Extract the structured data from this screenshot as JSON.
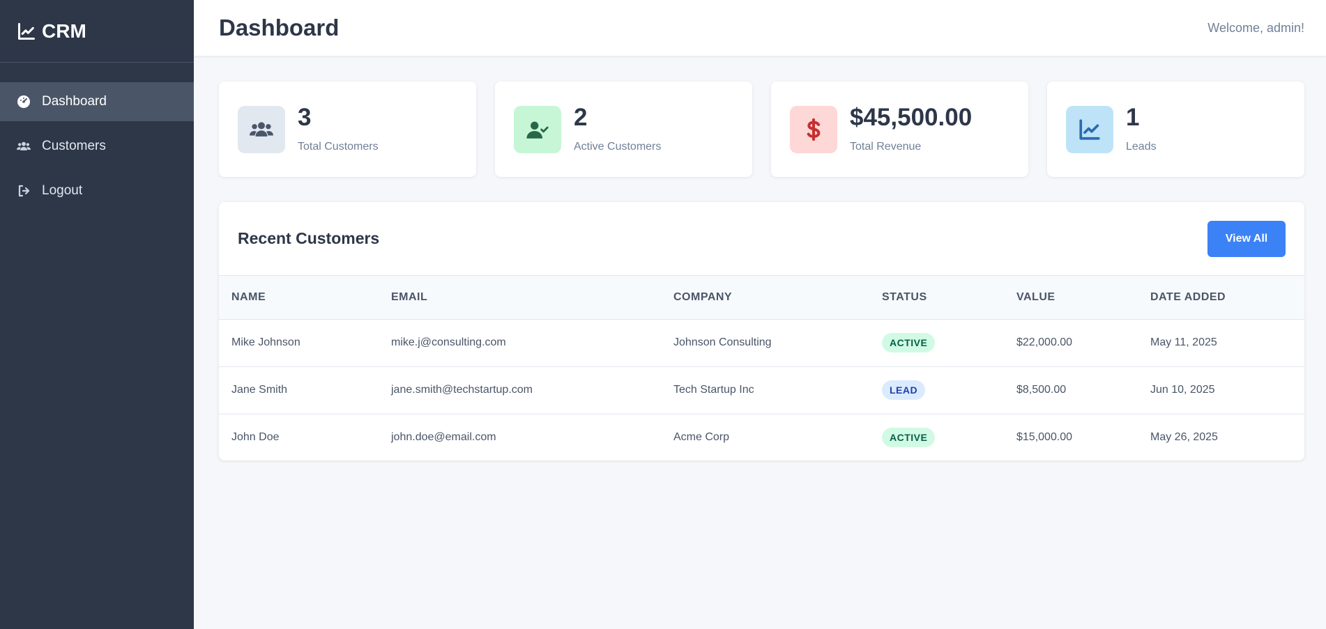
{
  "brand": {
    "name": "CRM"
  },
  "sidebar": {
    "items": [
      {
        "label": "Dashboard",
        "icon": "dashboard-icon",
        "active": true
      },
      {
        "label": "Customers",
        "icon": "users-icon",
        "active": false
      },
      {
        "label": "Logout",
        "icon": "logout-icon",
        "active": false
      }
    ]
  },
  "header": {
    "title": "Dashboard",
    "welcome": "Welcome, admin!"
  },
  "stats": [
    {
      "value": "3",
      "label": "Total Customers",
      "icon": "users-icon",
      "bg": "#e2e8f0",
      "color": "#4a5568"
    },
    {
      "value": "2",
      "label": "Active Customers",
      "icon": "user-check-icon",
      "bg": "#c6f6d5",
      "color": "#276749"
    },
    {
      "value": "$45,500.00",
      "label": "Total Revenue",
      "icon": "dollar-icon",
      "bg": "#fed7d7",
      "color": "#c53030"
    },
    {
      "value": "1",
      "label": "Leads",
      "icon": "chart-line-icon",
      "bg": "#bee3f8",
      "color": "#2b6cb0"
    }
  ],
  "recent": {
    "title": "Recent Customers",
    "view_all_label": "View All",
    "columns": [
      "NAME",
      "EMAIL",
      "COMPANY",
      "STATUS",
      "VALUE",
      "DATE ADDED"
    ],
    "rows": [
      {
        "name": "Mike Johnson",
        "email": "mike.j@consulting.com",
        "company": "Johnson Consulting",
        "status": "ACTIVE",
        "value": "$22,000.00",
        "date": "May 11, 2025"
      },
      {
        "name": "Jane Smith",
        "email": "jane.smith@techstartup.com",
        "company": "Tech Startup Inc",
        "status": "LEAD",
        "value": "$8,500.00",
        "date": "Jun 10, 2025"
      },
      {
        "name": "John Doe",
        "email": "john.doe@email.com",
        "company": "Acme Corp",
        "status": "ACTIVE",
        "value": "$15,000.00",
        "date": "May 26, 2025"
      }
    ]
  },
  "colors": {
    "sidebar_bg": "#2d3748",
    "accent": "#3b82f6",
    "active_badge": "#d1fae5",
    "lead_badge": "#dbeafe"
  }
}
